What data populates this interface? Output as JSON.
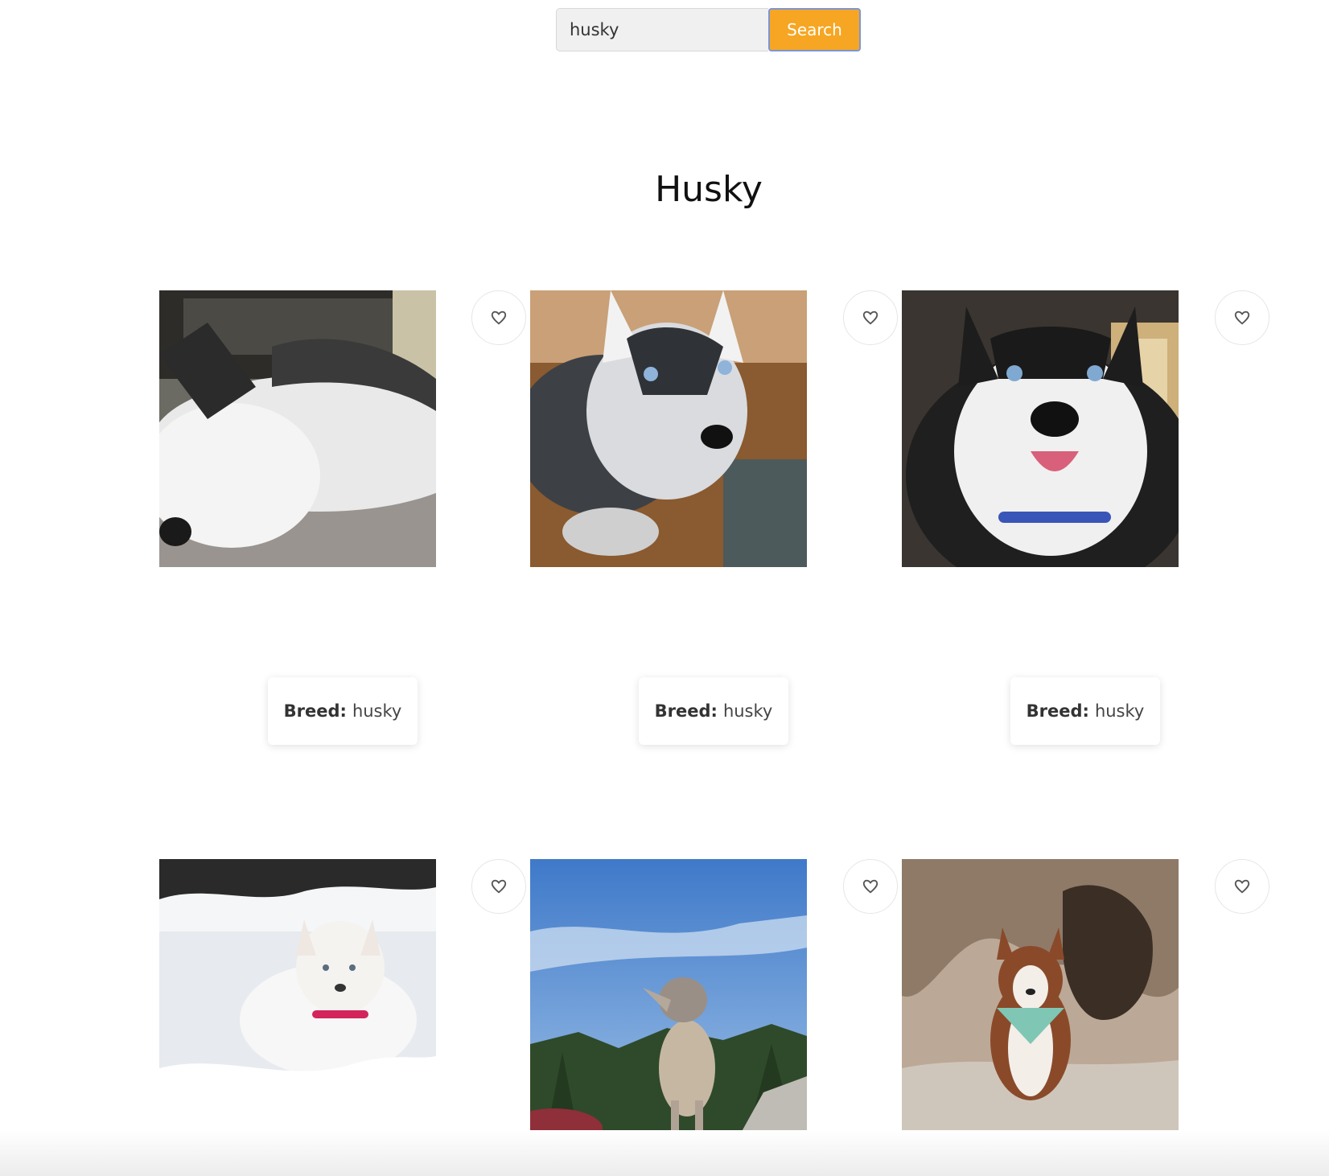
{
  "search": {
    "value": "husky",
    "button_label": "Search"
  },
  "title": "Husky",
  "cards": [
    {
      "breed_label": "Breed:",
      "breed_value": "husky"
    },
    {
      "breed_label": "Breed:",
      "breed_value": "husky"
    },
    {
      "breed_label": "Breed:",
      "breed_value": "husky"
    }
  ],
  "icons": {
    "favorite": "heart-outline-icon"
  },
  "colors": {
    "search_button": "#f6a623",
    "search_button_border": "#7b96d6",
    "input_bg": "#f0f0f0"
  }
}
